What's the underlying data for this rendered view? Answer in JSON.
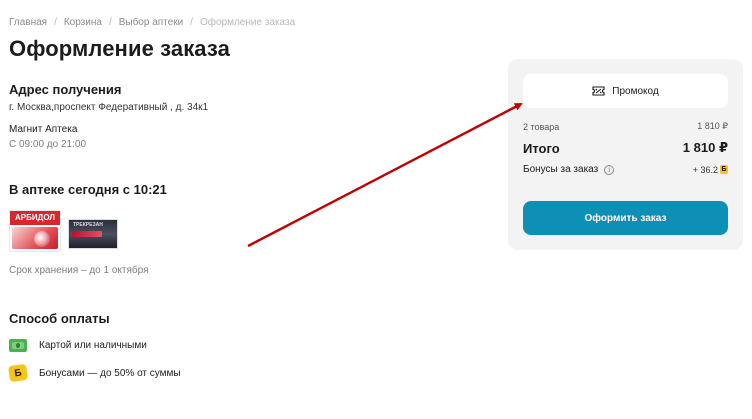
{
  "breadcrumb": {
    "items": [
      "Главная",
      "Корзина",
      "Выбор аптеки"
    ],
    "current": "Оформление заказа"
  },
  "page_title": "Оформление заказа",
  "address": {
    "title": "Адрес получения",
    "line": "г. Москва,проспект Федеративный , д. 34к1",
    "pharmacy_name": "Магнит Аптека",
    "hours": "С 09:00 до 21:00"
  },
  "availability": {
    "title": "В аптеке сегодня с 10:21",
    "products": [
      {
        "name": "АРБИДОЛ",
        "icon": "arbidol-package"
      },
      {
        "name": "ТРЕКРЕЗАН",
        "icon": "trekrezan-package"
      }
    ],
    "shelf_life": "Срок хранения – до 1 октября"
  },
  "payment": {
    "title": "Способ оплаты",
    "options": [
      {
        "label": "Картой или наличными",
        "icon": "card-cash-icon"
      },
      {
        "label": "Бонусами — до 50% от суммы",
        "icon": "bonus-icon",
        "icon_glyph": "Б"
      }
    ]
  },
  "summary": {
    "promo_label": "Промокод",
    "items_label": "2 товара",
    "items_sum": "1 810 ₽",
    "total_label": "Итого",
    "total_value": "1 810 ₽",
    "bonus_label": "Бонусы за заказ",
    "bonus_value": "+ 36.2",
    "bonus_glyph": "Б",
    "info_glyph": "i",
    "checkout_label": "Оформить заказ"
  },
  "colors": {
    "accent": "#0e8fb5",
    "annotation_arrow": "#c00000",
    "bonus_yellow": "#f5c518",
    "card_green": "#4caf50"
  }
}
